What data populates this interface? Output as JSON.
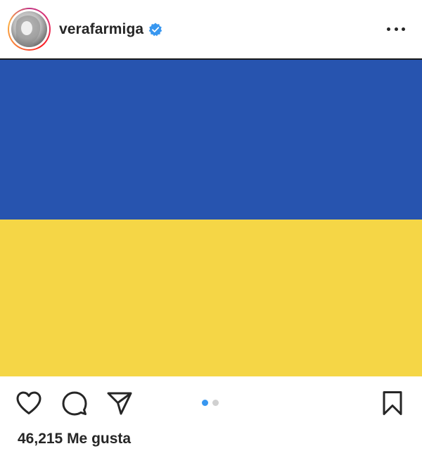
{
  "header": {
    "username": "verafarmiga",
    "verified": true,
    "avatar_icon": "profile-photo",
    "more_icon": "more-horizontal-icon"
  },
  "photo": {
    "colors": {
      "top": "#2754af",
      "bottom": "#f5d646"
    }
  },
  "actions": {
    "icons": [
      "heart-icon",
      "comment-icon",
      "share-icon",
      "bookmark-icon"
    ],
    "carousel": {
      "count": 2,
      "active_index": 0,
      "active_color": "#3897f0"
    }
  },
  "likes": {
    "text": "46,215 Me gusta"
  },
  "colors": {
    "verified_badge": "#3897f0",
    "text": "#262626"
  }
}
